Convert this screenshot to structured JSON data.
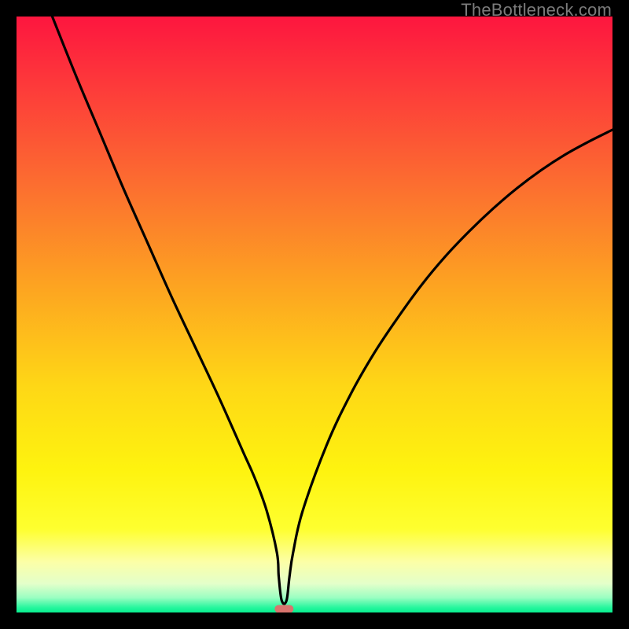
{
  "watermark": "TheBottleneck.com",
  "chart_data": {
    "type": "line",
    "title": "",
    "xlabel": "",
    "ylabel": "",
    "xlim": [
      0,
      100
    ],
    "ylim": [
      0,
      100
    ],
    "series": [
      {
        "name": "bottleneck-curve",
        "x": [
          6,
          10,
          14,
          18,
          22,
          26,
          30,
          34,
          38,
          40,
          42,
          43.7,
          44,
          44.5,
          45.3,
          45.8,
          46.4,
          48,
          52,
          56,
          60,
          64,
          68,
          72,
          76,
          80,
          84,
          88,
          92,
          96,
          100
        ],
        "y": [
          100,
          90,
          80.5,
          71,
          62,
          53,
          44.5,
          36,
          27,
          22.5,
          17,
          10,
          6,
          2,
          2,
          6,
          10,
          17,
          28,
          36.5,
          43.5,
          49.5,
          55,
          59.8,
          64,
          67.8,
          71.2,
          74.2,
          76.8,
          79,
          81
        ]
      }
    ],
    "marker": {
      "name": "optimal-point",
      "x": 44.9,
      "y": 0.6,
      "color": "#d9746e"
    },
    "gradient_stops": [
      {
        "offset": 0.0,
        "color": "#fd163f"
      },
      {
        "offset": 0.12,
        "color": "#fd3b3a"
      },
      {
        "offset": 0.28,
        "color": "#fc6d30"
      },
      {
        "offset": 0.45,
        "color": "#fda321"
      },
      {
        "offset": 0.62,
        "color": "#fed716"
      },
      {
        "offset": 0.76,
        "color": "#fef30f"
      },
      {
        "offset": 0.86,
        "color": "#feff2f"
      },
      {
        "offset": 0.915,
        "color": "#fcffa7"
      },
      {
        "offset": 0.952,
        "color": "#e3ffca"
      },
      {
        "offset": 0.975,
        "color": "#9bfec2"
      },
      {
        "offset": 0.992,
        "color": "#25f69d"
      },
      {
        "offset": 1.0,
        "color": "#08ee8e"
      }
    ]
  }
}
